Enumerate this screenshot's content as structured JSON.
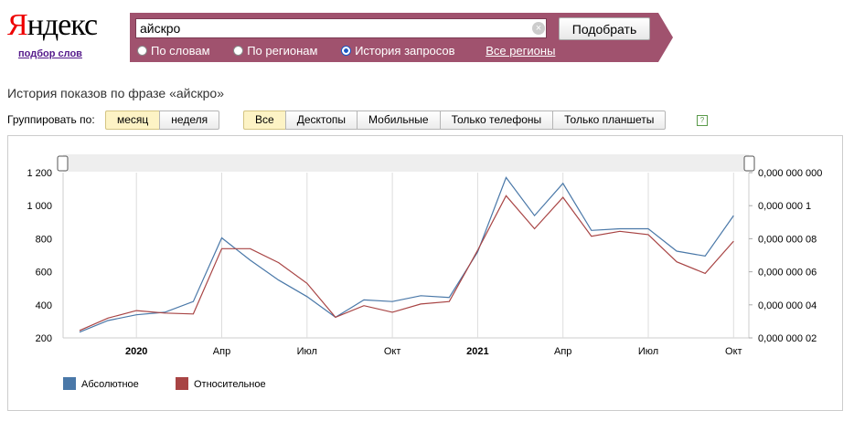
{
  "logo": {
    "first_letter": "Я",
    "rest": "ндекс",
    "sub": "подбор слов"
  },
  "search": {
    "query": "айскро",
    "submit_label": "Подобрать",
    "clear_icon": "×"
  },
  "modes": [
    {
      "label": "По словам",
      "selected": false
    },
    {
      "label": "По регионам",
      "selected": false
    },
    {
      "label": "История запросов",
      "selected": true
    }
  ],
  "all_regions": "Все регионы",
  "page_title": "История показов по фразе «айскро»",
  "group_label": "Группировать по:",
  "group_buttons": [
    {
      "label": "месяц",
      "selected": true
    },
    {
      "label": "неделя",
      "selected": false
    }
  ],
  "device_buttons": [
    {
      "label": "Все",
      "selected": true
    },
    {
      "label": "Десктопы",
      "selected": false
    },
    {
      "label": "Мобильные",
      "selected": false
    },
    {
      "label": "Только телефоны",
      "selected": false
    },
    {
      "label": "Только планшеты",
      "selected": false
    }
  ],
  "help_icon": "?",
  "colors": {
    "absolute": "#4a78a8",
    "relative": "#a84444",
    "brand": "#a0526e"
  },
  "chart_data": {
    "type": "line",
    "x": [
      "2019-11",
      "2019-12",
      "2020-01",
      "2020-02",
      "2020-03",
      "2020-04",
      "2020-05",
      "2020-06",
      "2020-07",
      "2020-08",
      "2020-09",
      "2020-10",
      "2020-11",
      "2020-12",
      "2021-01",
      "2021-02",
      "2021-03",
      "2021-04",
      "2021-05",
      "2021-06",
      "2021-07",
      "2021-08",
      "2021-09",
      "2021-10",
      "2021-11"
    ],
    "x_tick_labels": [
      "2020",
      "Апр",
      "Июл",
      "Окт",
      "2021",
      "Апр",
      "Июл",
      "Окт"
    ],
    "x_tick_bold": [
      true,
      false,
      false,
      false,
      true,
      false,
      false,
      false
    ],
    "series": [
      {
        "name": "Абсолютное",
        "axis": "left",
        "values": [
          235,
          305,
          340,
          355,
          420,
          805,
          670,
          550,
          450,
          325,
          430,
          420,
          455,
          445,
          720,
          1170,
          940,
          1135,
          850,
          860,
          860,
          725,
          695,
          940
        ]
      },
      {
        "name": "Относительное",
        "axis": "right",
        "values": [
          2.45e-08,
          3.2e-08,
          3.65e-08,
          3.5e-08,
          3.45e-08,
          7.4e-08,
          7.4e-08,
          6.55e-08,
          5.3e-08,
          3.25e-08,
          3.95e-08,
          3.55e-08,
          4.05e-08,
          4.2e-08,
          7.3e-08,
          1.06e-07,
          8.6e-08,
          1.05e-07,
          8.15e-08,
          8.45e-08,
          8.25e-08,
          6.6e-08,
          5.9e-08,
          7.85e-08
        ]
      }
    ],
    "y_left": {
      "min": 200,
      "max": 1200,
      "ticks": [
        "200",
        "400",
        "600",
        "800",
        "1 000",
        "1 200"
      ]
    },
    "y_right": {
      "min": 2e-08,
      "max": 1.2e-07,
      "ticks": [
        "0,000 000 02",
        "0,000 000 04",
        "0,000 000 06",
        "0,000 000 08",
        "0,000 000 1",
        "0,000 000 000"
      ]
    },
    "grid": true,
    "legend": "bottom-left"
  }
}
